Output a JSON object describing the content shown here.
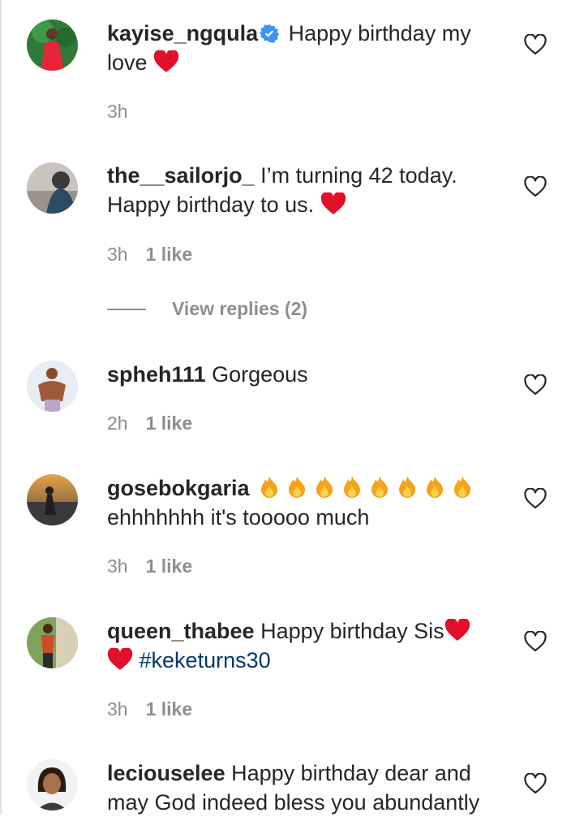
{
  "comments": [
    {
      "username": "kayise_ngqula",
      "verified": true,
      "text": " Happy birthday my love ",
      "time": "3h",
      "likes": ""
    },
    {
      "username": "the__sailorjo_",
      "text": " I’m turning 42 today. Happy birthday to us. ",
      "time": "3h",
      "likes": "1 like"
    },
    {
      "username": "spheh111",
      "text": " Gorgeous",
      "time": "2h",
      "likes": "1 like"
    },
    {
      "username": "gosebokgaria",
      "text": " ",
      "text2": "ehhhhhhh it's tooooo much",
      "time": "3h",
      "likes": "1 like"
    },
    {
      "username": "queen_thabee",
      "text": " Happy birthday Sis",
      "hashtag": "#keketurns30",
      "time": "3h",
      "likes": "1 like"
    },
    {
      "username": "leciouselee",
      "text": " Happy birthday dear and may God indeed bless you abundantly"
    }
  ],
  "view_replies": "View replies (2)",
  "colors": {
    "text": "#262626",
    "meta": "#8e8e8e",
    "heart_emoji": "#e0102a",
    "fire": "#f7a21b",
    "verified": "#3897f0",
    "hashtag": "#00376b"
  },
  "icons": {
    "like": "heart-outline-icon",
    "verified": "verified-badge-icon",
    "love": "red-heart-emoji",
    "fire": "fire-emoji"
  }
}
